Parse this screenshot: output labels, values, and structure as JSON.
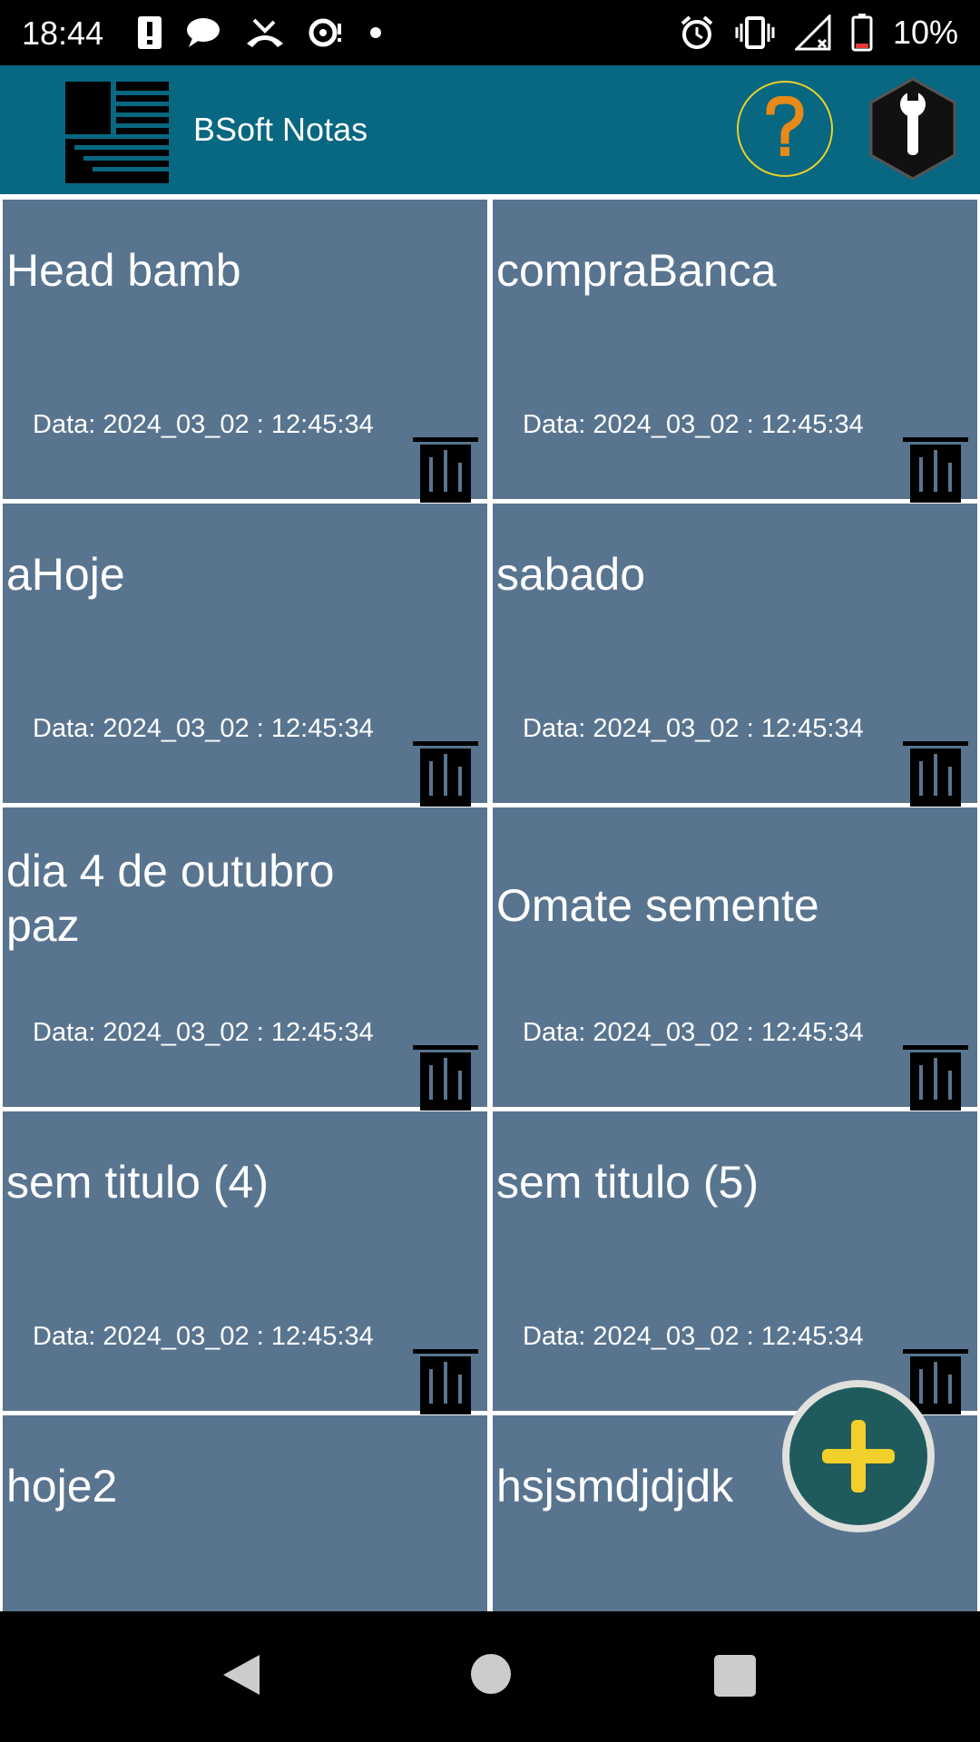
{
  "status_bar": {
    "time": "18:44",
    "battery_text": "10%",
    "icons_left": [
      "alert-icon",
      "chat-icon",
      "missed-call-icon",
      "sync-icon",
      "dot-icon"
    ],
    "icons_right": [
      "alarm-icon",
      "vibrate-icon",
      "signal-icon",
      "battery-icon"
    ]
  },
  "app_bar": {
    "title": "BSoft Notas",
    "accent_color": "#086781",
    "help_symbol": "?"
  },
  "notes": [
    {
      "title": "Head bamb",
      "date": "Data: 2024_03_02 : 12:45:34"
    },
    {
      "title": "compraBanca",
      "date": "Data: 2024_03_02 : 12:45:34"
    },
    {
      "title": "aHoje",
      "date": "Data: 2024_03_02 : 12:45:34"
    },
    {
      "title": "sabado",
      "date": "Data: 2024_03_02 : 12:45:34"
    },
    {
      "title": "dia 4 de outubro paz",
      "date": "Data: 2024_03_02 : 12:45:34"
    },
    {
      "title": "Omate semente",
      "date": "Data: 2024_03_02 : 12:45:34"
    },
    {
      "title": "sem titulo (4)",
      "date": "Data: 2024_03_02 : 12:45:34"
    },
    {
      "title": "sem titulo (5)",
      "date": "Data: 2024_03_02 : 12:45:34"
    },
    {
      "title": "hoje2",
      "date": ""
    },
    {
      "title": "hsjsmdjdjdk",
      "date": ""
    }
  ],
  "colors": {
    "card": "#59748f",
    "fab": "#1f5b5d",
    "fab_plus": "#f2d02b"
  }
}
